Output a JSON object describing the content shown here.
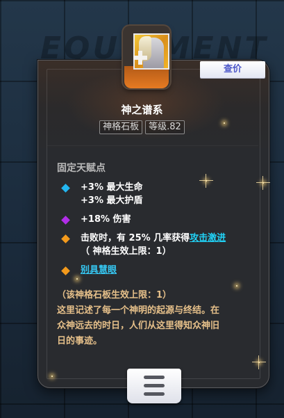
{
  "background": {
    "watermark": "EQUIPMENT"
  },
  "item": {
    "name": "神之谱系",
    "type_tag": "神格石板",
    "level_tag": "等级.82",
    "check_button": "查价"
  },
  "talent": {
    "section_title": "固定天赋点",
    "entries": [
      {
        "color": "#23b6f0",
        "lines": [
          "+3% 最大生命",
          "+3% 最大护盾"
        ]
      },
      {
        "color": "#b12ee8",
        "lines": [
          "+18% 伤害"
        ]
      },
      {
        "color": "#f39a1c",
        "line1_prefix": "击败时，有 25% 几率获得",
        "line1_link": "攻击激进",
        "line2": "（ 神格生效上限：1）"
      },
      {
        "color": "#f39a1c",
        "link": "别具慧眼"
      }
    ]
  },
  "description": {
    "limit": "（该神格石板生效上限：1）",
    "lines": [
      "这里记述了每一个神明的起源与终结。在",
      "众神远去的时日，人们从这里得知众神旧",
      "日的事迹。"
    ]
  },
  "icons": {
    "menu": "hamburger-menu-icon",
    "portrait": "deity-portrait-icon",
    "plus": "plus-icon"
  }
}
